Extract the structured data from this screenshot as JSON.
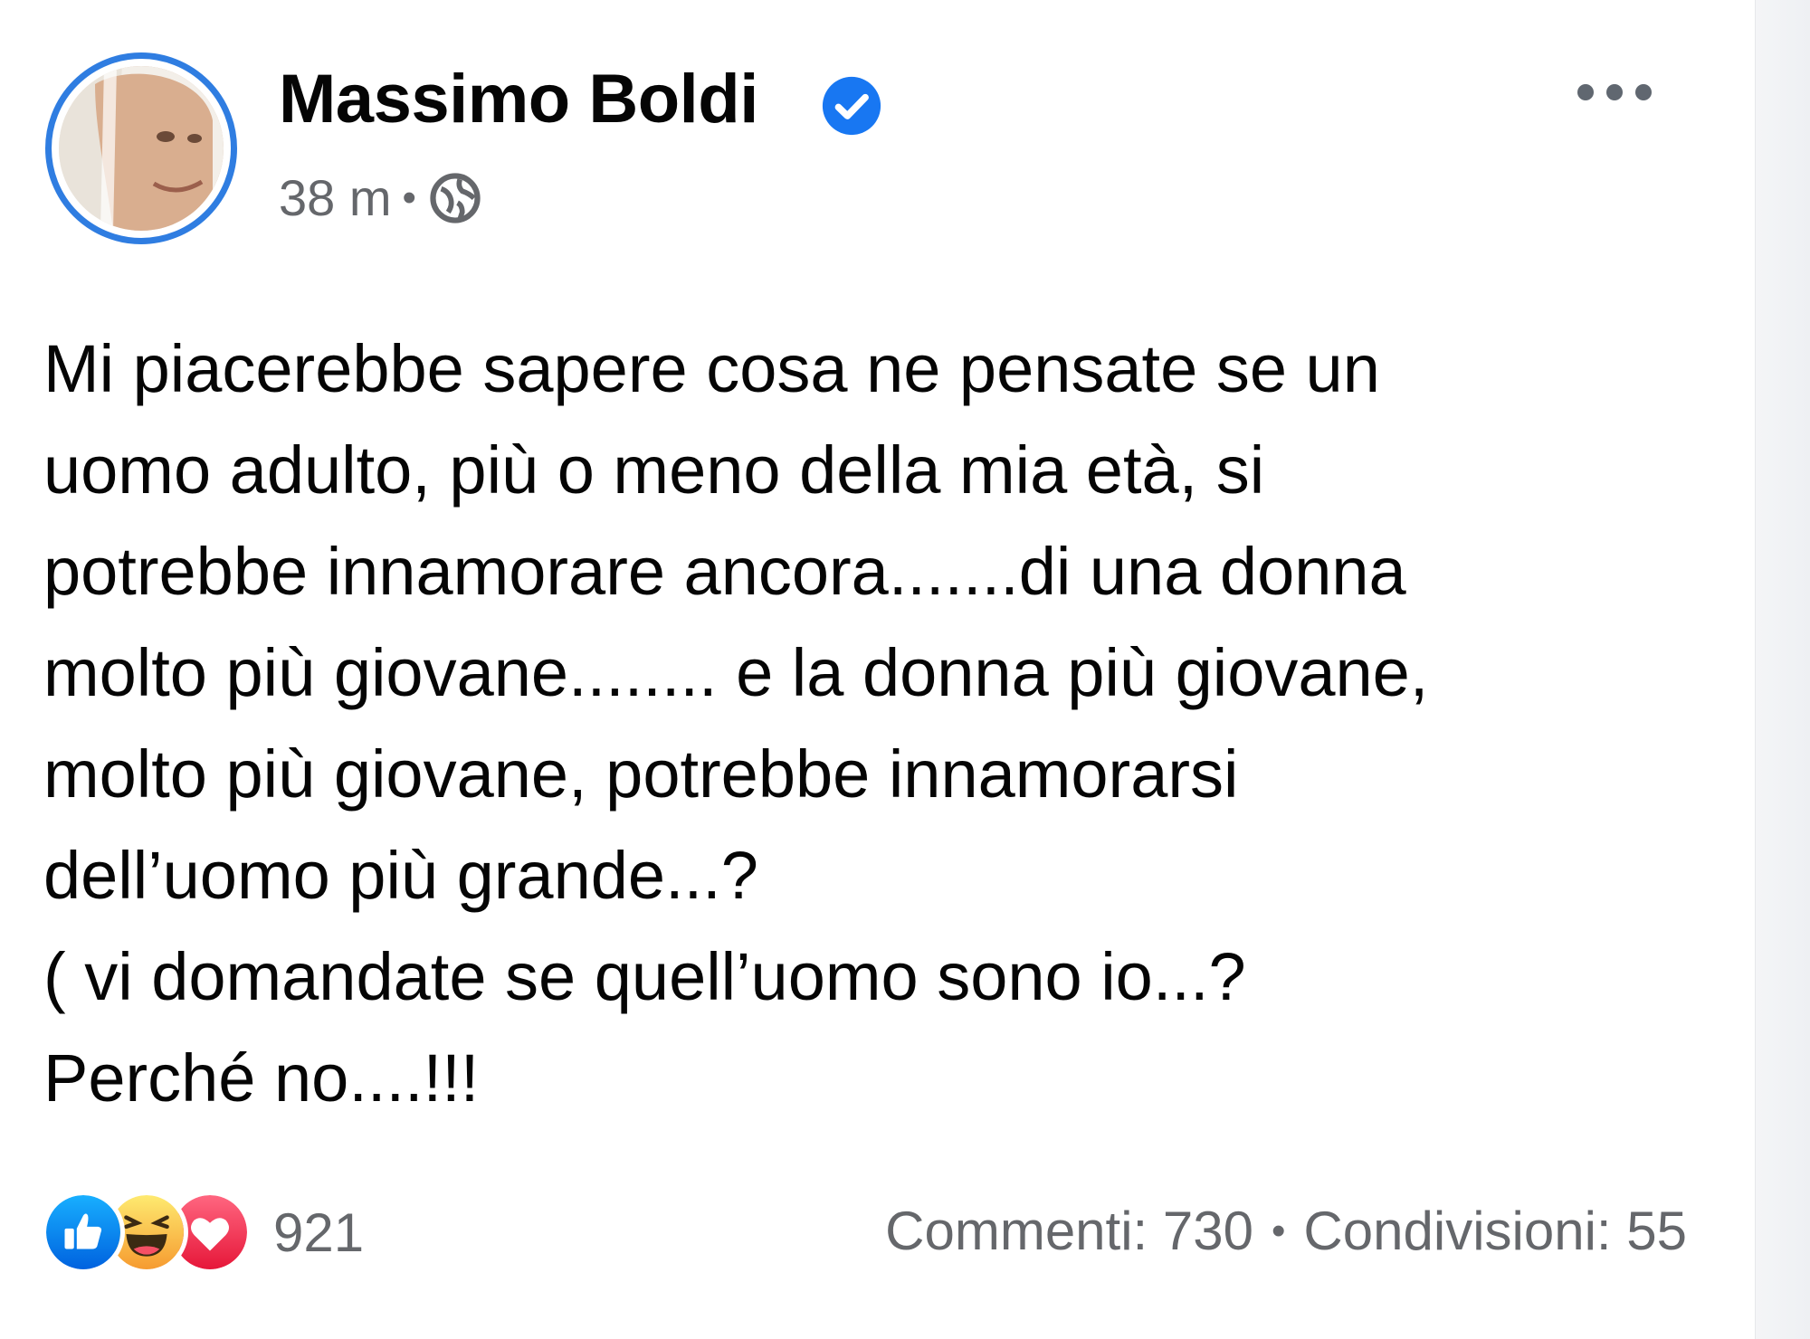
{
  "post": {
    "author": {
      "name": "Massimo Boldi",
      "verified": true
    },
    "meta": {
      "time": "38 m",
      "separator": "•",
      "audience_icon": "globe-icon"
    },
    "more_icon": "more-horizontal-icon",
    "text": "Mi piacerebbe sapere cosa ne pensate se un\nuomo adulto, più o meno della mia età, si\npotrebbe innamorare ancora.......di una donna\nmolto più giovane........ e la donna più giovane,\nmolto più giovane, potrebbe innamorarsi\ndell’uomo più grande...?\n( vi domandate se quell’uomo sono io...?\nPerché no....!!!",
    "reactions": {
      "icons": [
        "like-icon",
        "haha-icon",
        "love-icon"
      ],
      "count": "921"
    },
    "stats": {
      "comments": "Commenti: 730",
      "separator": "•",
      "shares": "Condivisioni: 55"
    }
  },
  "colors": {
    "accent": "#2f7de1",
    "like": "#1877f2",
    "haha": "#f7b125",
    "love": "#f33e58",
    "secondary_text": "#65676b"
  }
}
